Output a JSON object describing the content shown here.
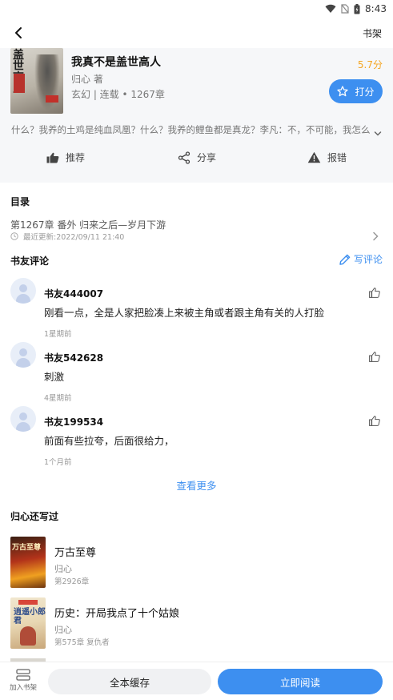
{
  "status_bar": {
    "time": "8:43"
  },
  "nav": {
    "right_label": "书架"
  },
  "book": {
    "cover_text": "盖世高人",
    "title": "我真不是盖世高人",
    "author": "归心 著",
    "meta": "玄幻 | 连载 • 1267章",
    "score": "5.7分",
    "rate_label": "打分",
    "intro": "什么？我养的土鸡是纯血凤凰？什么？我养的鲤鱼都是真龙？李凡：不，不可能，我怎么"
  },
  "actions": {
    "recommend": "推荐",
    "share": "分享",
    "report": "报错"
  },
  "catalog": {
    "title": "目录",
    "latest_chapter": "第1267章 番外 归来之后—岁月下游",
    "last_update": "最近更新:2022/09/11 21:40"
  },
  "reviews": {
    "title": "书友评论",
    "write_label": "写评论",
    "view_more": "查看更多",
    "items": [
      {
        "user": "书友444007",
        "text": "刚看一点，全是人家把脸凑上来被主角或者跟主角有关的人打脸",
        "time": "1星期前"
      },
      {
        "user": "书友542628",
        "text": "刺激",
        "time": "4星期前"
      },
      {
        "user": "书友199534",
        "text": "前面有些拉夸，后面很给力，",
        "time": "1个月前"
      }
    ]
  },
  "author_books": {
    "title": "归心还写过",
    "items": [
      {
        "cover_text": "万古至尊",
        "title": "万古至尊",
        "author": "归心",
        "chapter": "第2926章"
      },
      {
        "cover_text": "逍遥小郎君",
        "title": "历史：开局我点了十个姑娘",
        "author": "归心",
        "chapter": "第575章 复仇者"
      }
    ]
  },
  "bottom_bar": {
    "add_shelf": "加入书架",
    "cache_all": "全本缓存",
    "read_now": "立即阅读"
  },
  "colors": {
    "accent": "#3d8ff0",
    "score": "#f5a623"
  }
}
